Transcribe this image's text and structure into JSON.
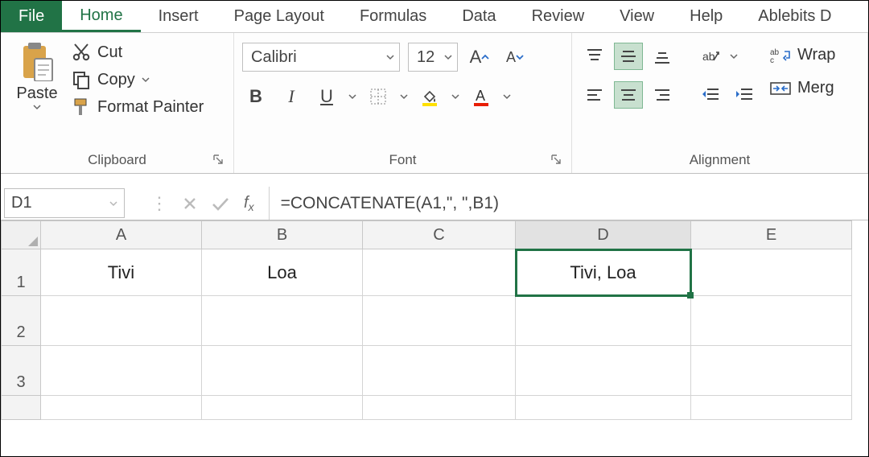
{
  "tabs": {
    "file": "File",
    "home": "Home",
    "insert": "Insert",
    "pageLayout": "Page Layout",
    "formulas": "Formulas",
    "data": "Data",
    "review": "Review",
    "view": "View",
    "help": "Help",
    "ablebits": "Ablebits D"
  },
  "clipboard": {
    "paste": "Paste",
    "cut": "Cut",
    "copy": "Copy",
    "formatPainter": "Format Painter",
    "groupLabel": "Clipboard"
  },
  "font": {
    "name": "Calibri",
    "size": "12",
    "bold": "B",
    "italic": "I",
    "underline": "U",
    "groupLabel": "Font"
  },
  "alignment": {
    "wrap": "Wrap",
    "merge": "Merg",
    "groupLabel": "Alignment"
  },
  "nameBox": "D1",
  "formula": "=CONCATENATE(A1,\", \",B1)",
  "columns": [
    "A",
    "B",
    "C",
    "D",
    "E"
  ],
  "rows": [
    "1",
    "2",
    "3"
  ],
  "cells": {
    "A1": "Tivi",
    "B1": "Loa",
    "D1": "Tivi, Loa"
  },
  "selectedCell": "D1"
}
